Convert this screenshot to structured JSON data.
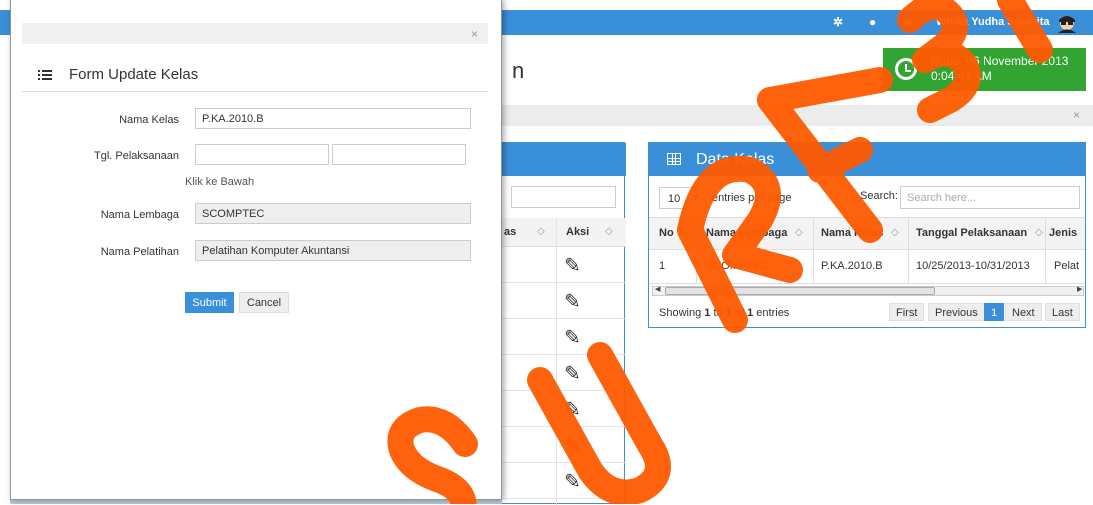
{
  "topbar": {
    "icons": [
      "gear-icon",
      "drop-icon",
      "lock-icon"
    ],
    "user_name": "Whika Yudha Sasmita"
  },
  "page": {
    "title_fragment": "n"
  },
  "clock": {
    "date": "Rabu, 06 November 2013",
    "time": "0:04:44 AM"
  },
  "left_table": {
    "header_cols": [
      "as",
      "Aksi"
    ],
    "rows": 7
  },
  "data_kelas": {
    "title": "Data Kelas",
    "per_page_value": "10",
    "per_page_label": "entries per page",
    "search_label": "Search:",
    "search_placeholder": "Search here...",
    "columns": [
      "No",
      "Nama Lembaga",
      "Nama Kelas",
      "Tanggal Pelaksanaan",
      "Jenis"
    ],
    "rows": [
      {
        "no": "1",
        "lembaga": "SCOMPTEC",
        "kelas": "P.KA.2010.B",
        "tanggal": "10/25/2013-10/31/2013",
        "jenis": "Pelat"
      }
    ],
    "showing_prefix": "Showing ",
    "showing_from": "1",
    "showing_to_word": " to ",
    "showing_to": "1",
    "showing_of_word": " of ",
    "showing_total": "1",
    "showing_suffix": " entries",
    "pagination": {
      "first": "First",
      "previous": "Previous",
      "current": "1",
      "next": "Next",
      "last": "Last"
    }
  },
  "modal": {
    "close": "×",
    "title": "Form Update Kelas",
    "fields": {
      "nama_kelas_label": "Nama Kelas",
      "nama_kelas_value": "P.KA.2010.B",
      "tgl_label": "Tgl. Pelaksanaan",
      "tgl_start_value": "",
      "tgl_end_value": "",
      "hint": "Klik ke Bawah",
      "lembaga_label": "Nama Lembaga",
      "lembaga_value": "SCOMPTEC",
      "pelatihan_label": "Nama Pelatihan",
      "pelatihan_value": "Pelatihan Komputer Akuntansi"
    },
    "submit_label": "Submit",
    "cancel_label": "Cancel"
  },
  "breadcrumb": {
    "close": "×"
  },
  "colors": {
    "primary": "#3a8fd9",
    "clock": "#32a431",
    "watermark": "#ff5a00"
  }
}
